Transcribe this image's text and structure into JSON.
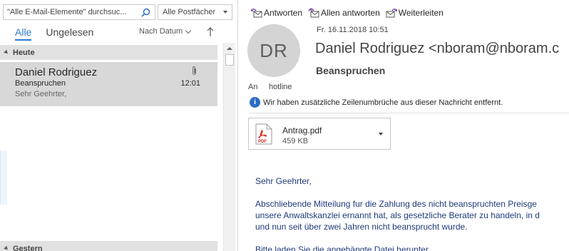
{
  "search": {
    "value": "\"Alle E-Mail-Elemente\" durchsuc...",
    "scope": "Alle Postfächer"
  },
  "filters": {
    "all": "Alle",
    "unread": "Ungelesen",
    "sort": "Nach Datum"
  },
  "groups": {
    "today": "Heute",
    "yesterday": "Gestern"
  },
  "mail_item": {
    "from": "Daniel Rodriguez",
    "subject": "Beanspruchen",
    "preview": "Sehr Geehrter,",
    "time": "12:01"
  },
  "actions": {
    "reply": "Antworten",
    "reply_all": "Allen antworten",
    "forward": "Weiterleiten"
  },
  "message": {
    "initials": "DR",
    "date": "Fr. 16.11.2018 10:51",
    "sender": "Daniel Rodriguez <nboram@nboram.c",
    "subject": "Beanspruchen",
    "to_label": "An",
    "to_value": "hotline",
    "info": "Wir haben zusätzliche Zeilenumbrüche aus dieser Nachricht entfernt."
  },
  "attachment": {
    "name": "Antrag.pdf",
    "size": "459 KB",
    "icon_text": "PDF"
  },
  "body": {
    "greeting": "Sehr Geehrter,",
    "para1_line1": "Abschliebende Mitteilung fur die Zahlung des nicht beanspruchten Preisge",
    "para1_line2": "unsere Anwaltskanzlei ernannt hat, als gesetzliche Berater zu handeln, in d",
    "para1_line3": "und nun seit über zwei Jahren nicht beansprucht wurde.",
    "para2": "Bitte laden Sie die angehängte Datei herunter"
  },
  "colors": {
    "accent": "#2b7cd3",
    "selected_item": "#d8d8d8",
    "group_header": "#e1e1e1",
    "body_text": "#1f3a7a",
    "pdf_red": "#d9261c"
  }
}
